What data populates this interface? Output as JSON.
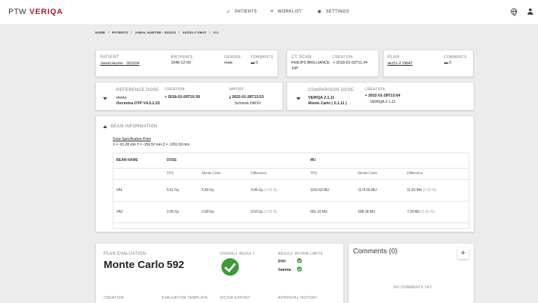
{
  "app": {
    "logo_ptw": "PTW",
    "logo_name": "VERIQA"
  },
  "nav": {
    "patients": {
      "icon": "✓",
      "label": "PATIENTS"
    },
    "worklist": {
      "icon": "≡",
      "label": "WORKLIST"
    },
    "settings": {
      "icon": "✱",
      "label": "SETTINGS"
    }
  },
  "breadcrumb": [
    "HOME",
    "PATIENTS",
    "JAMAL HUNTER - 001024",
    "AKZ51-2 VMAT",
    "592"
  ],
  "patient": {
    "label": "PATIENT",
    "name": "Jamal Hunter - 001024",
    "birthdate_label": "BIRTHDATE",
    "birthdate": "1948-12-09",
    "gender_label": "GENDER",
    "gender": "male",
    "comments_label": "COMMENTS",
    "comments_icon": "▬",
    "comments": "0"
  },
  "ct_scan": {
    "label": "CT SCAN",
    "scanner_line1": "PHILIPS BRILLIANCE",
    "scanner_line2": "16P",
    "creation_label": "CREATION",
    "creation_icon": "+",
    "creation": "2018-01-02T11:24"
  },
  "plan": {
    "label": "PLAN",
    "name": "akz51-2 VMAT",
    "comments_label": "COMMENTS",
    "comments_icon": "▬",
    "comments": "0"
  },
  "reference_dose": {
    "label": "REFERENCE DOSE",
    "vendor": "elekta",
    "system": "Oncentra OTP V4.5.2.23",
    "creation_label": "CREATION",
    "creation_icon": "+",
    "creation": "2018-01-09T10:39",
    "import_label": "IMPORT",
    "import_icon": "⤓",
    "import": "2022-01-28T13:53",
    "import_user": "Schrenk DW10"
  },
  "comparison_dose": {
    "label": "COMPARISON DOSE",
    "system": "VERIQA 2.1.11",
    "engine": "Monte Carlo ( 2.1.11 )",
    "creation_label": "CREATION",
    "creation_icon": "+",
    "creation": "2022-01-28T13:54",
    "creation_sub": "VERIQA 2.1.11"
  },
  "beam_info": {
    "title": "BEAM INFORMATION",
    "dsp_label": "Dose Specification Point",
    "dsp_coords": "X = -61.28 mm   Y = -156.52 mm   Z = -1351.50 mm",
    "headers": {
      "beam_name": "BEAM NAME",
      "dose": "DOSE",
      "mu": "MU"
    },
    "subheaders": {
      "tps": "TPS",
      "mc": "Monte Carlo",
      "diff": "Difference",
      "tps2": "TPS",
      "mc2": "Monte Carlo",
      "diff2": "Difference"
    },
    "rows": [
      {
        "name": "VA1",
        "dose_tps": "5.61 Gy",
        "dose_mc": "5.66 Gy",
        "dose_diff": "0.06 Gy",
        "dose_pct": "(1.03 %)",
        "mu_tps": "1162.63 MU",
        "mu_mc": "1174.55 MU",
        "mu_diff": "11.92 MU",
        "mu_pct": "(1.03 %)"
      },
      {
        "name": "VA2",
        "dose_tps": "2.96 Gy",
        "dose_mc": "2.99 Gy",
        "dose_diff": "0.03 Gy",
        "dose_pct": "(1.03 %)",
        "mu_tps": "691.10 MU",
        "mu_mc": "698.18 MU",
        "mu_diff": "7.09 MU",
        "mu_pct": "(1.03 %)"
      }
    ]
  },
  "plan_evaluation": {
    "label": "PLAN EVALUATION",
    "engine": "Monte Carlo",
    "id": "592",
    "overall_label": "OVERALL RESULT",
    "limits_label": "RESULT WITHIN LIMITS",
    "dvh": "DVH",
    "gamma": "Gamma",
    "creation_label": "CREATION",
    "template_label": "EVALUATION TEMPLATE",
    "dicom_label": "DICOM EXPORT",
    "approval_label": "APPROVAL HISTORY",
    "result_color": "#3e9a38"
  },
  "comments": {
    "title": "Comments (0)",
    "add": "+",
    "empty": "NO COMMENTS YET"
  }
}
